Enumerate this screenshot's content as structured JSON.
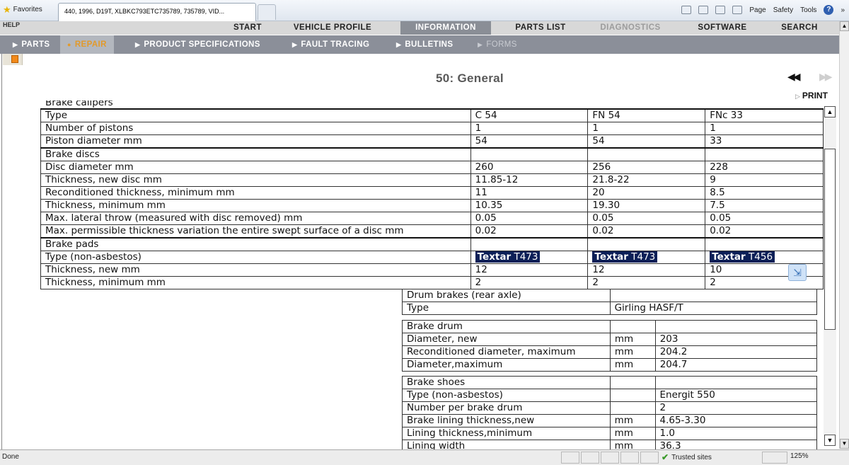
{
  "browser": {
    "favorites_label": "Favorites",
    "tab_title": "440, 1996, D19T, XLBKC793ETC735789, 735789, VID...",
    "commands": {
      "page": "Page",
      "safety": "Safety",
      "tools": "Tools"
    },
    "overflow": "»"
  },
  "app": {
    "help_label": "HELP",
    "top_nav": [
      "START",
      "VEHICLE PROFILE",
      "INFORMATION",
      "PARTS LIST",
      "DIAGNOSTICS",
      "SOFTWARE",
      "SEARCH"
    ],
    "active_top": "INFORMATION",
    "disabled_top": "DIAGNOSTICS",
    "sub_nav": [
      "PARTS",
      "REPAIR",
      "PRODUCT SPECIFICATIONS",
      "FAULT TRACING",
      "BULLETINS",
      "FORMS"
    ],
    "active_sub": "REPAIR",
    "disabled_sub": "FORMS"
  },
  "page": {
    "title": "50: General",
    "prev_label": "◀◀",
    "next_label": "▶▶",
    "print_label": "PRINT"
  },
  "calipers_table": {
    "cut_title": "Brake calipers",
    "rows": [
      [
        "Type",
        "C 54",
        "FN 54",
        "FNc 33"
      ],
      [
        "Number of pistons",
        "1",
        "1",
        "1"
      ],
      [
        "Piston diameter mm",
        "54",
        "54",
        "33"
      ],
      [
        "Brake discs",
        "",
        "",
        ""
      ],
      [
        "Disc diameter mm",
        "260",
        "256",
        "228"
      ],
      [
        "Thickness, new disc mm",
        "11.85-12",
        "21.8-22",
        "9"
      ],
      [
        "Reconditioned thickness, minimum mm",
        "11",
        "20",
        "8.5"
      ],
      [
        "Thickness, minimum mm",
        "10.35",
        "19.30",
        "7.5"
      ],
      [
        "Max. lateral throw (measured with disc removed) mm",
        "0.05",
        "0.05",
        "0.05"
      ],
      [
        "Max. permissible thickness variation the entire swept surface of a disc mm",
        "0.02",
        "0.02",
        "0.02"
      ],
      [
        "Brake pads",
        "",
        "",
        ""
      ],
      [
        "Type (non-asbestos)",
        "",
        "",
        ""
      ],
      [
        "Thickness, new mm",
        "12",
        "12",
        "10"
      ],
      [
        "Thickness, minimum mm",
        "2",
        "2",
        "2"
      ]
    ],
    "pad_types": [
      {
        "brand": "Textar",
        "code": "T473"
      },
      {
        "brand": "Textar",
        "code": "T473"
      },
      {
        "brand": "Textar",
        "code": "T456"
      }
    ]
  },
  "drum_table": {
    "rows": [
      [
        "Drum brakes (rear axle)",
        ""
      ],
      [
        "Type",
        "Girling HASF/T"
      ]
    ]
  },
  "brake_drum_table": {
    "rows": [
      [
        "Brake drum",
        "",
        ""
      ],
      [
        "Diameter, new",
        "mm",
        "203"
      ],
      [
        "Reconditioned diameter, maximum",
        "mm",
        "204.2"
      ],
      [
        "Diameter,maximum",
        "mm",
        "204.7"
      ]
    ]
  },
  "brake_shoes_table": {
    "rows": [
      [
        "Brake shoes",
        "",
        ""
      ],
      [
        "Type (non-asbestos)",
        "",
        "Energit 550"
      ],
      [
        "Number per brake drum",
        "",
        "2"
      ],
      [
        "Brake lining thickness,new",
        "mm",
        "4.65-3.30"
      ],
      [
        "Lining thickness,minimum",
        "mm",
        "1.0"
      ],
      [
        "Lining width",
        "mm",
        "36.3"
      ]
    ]
  },
  "status": {
    "left": "Done",
    "zone": "Trusted sites",
    "zoom": "125%"
  }
}
